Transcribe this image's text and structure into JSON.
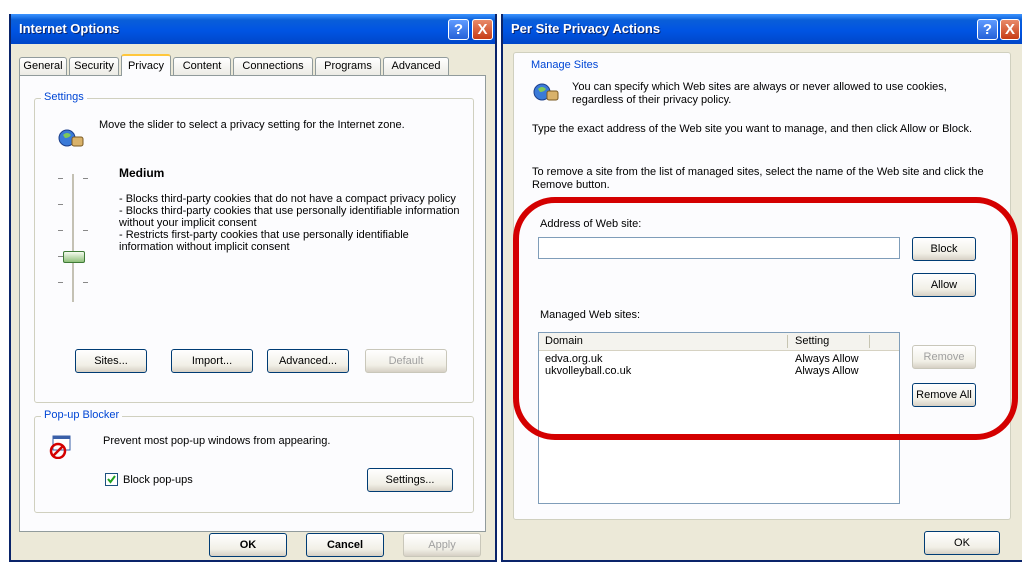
{
  "left_window": {
    "title": "Internet Options",
    "tabs": [
      "General",
      "Security",
      "Privacy",
      "Content",
      "Connections",
      "Programs",
      "Advanced"
    ],
    "active_tab": "Privacy",
    "settings_group": {
      "label": "Settings",
      "instruction": "Move the slider to select a privacy setting for the Internet zone.",
      "level": "Medium",
      "description": "- Blocks third-party cookies that do not have a compact privacy policy\n- Blocks third-party cookies that use personally identifiable information without your implicit consent\n- Restricts first-party cookies that use personally identifiable information without implicit consent",
      "buttons": {
        "sites": "Sites...",
        "import": "Import...",
        "advanced": "Advanced...",
        "default": "Default"
      }
    },
    "popup_group": {
      "label": "Pop-up Blocker",
      "text": "Prevent most pop-up windows from appearing.",
      "checkbox_label": "Block pop-ups",
      "checkbox_checked": true,
      "settings_button": "Settings..."
    },
    "footer_buttons": {
      "ok": "OK",
      "cancel": "Cancel",
      "apply": "Apply"
    }
  },
  "right_window": {
    "title": "Per Site Privacy Actions",
    "group_label": "Manage Sites",
    "intro": "You can specify which Web sites are always or never allowed to use cookies, regardless of their privacy policy.",
    "instruction1": "Type the exact address of the Web site you want to manage, and then click Allow or Block.",
    "instruction2": "To remove a site from the list of managed sites, select the name of the Web site and click the Remove button.",
    "address_label": "Address of Web site:",
    "address_value": "",
    "block_button": "Block",
    "allow_button": "Allow",
    "managed_label": "Managed Web sites:",
    "columns": {
      "domain": "Domain",
      "setting": "Setting"
    },
    "rows": [
      {
        "domain": "edva.org.uk",
        "setting": "Always Allow"
      },
      {
        "domain": "ukvolleyball.co.uk",
        "setting": "Always Allow"
      }
    ],
    "remove_button": "Remove",
    "remove_all_button": "Remove All",
    "ok_button": "OK"
  },
  "help_glyph": "?",
  "close_glyph": "X",
  "colors": {
    "titlebar": "#0054e3",
    "dialog_bg": "#ece9d8",
    "highlight_ring": "#d40000",
    "group_label": "#0046d5"
  }
}
